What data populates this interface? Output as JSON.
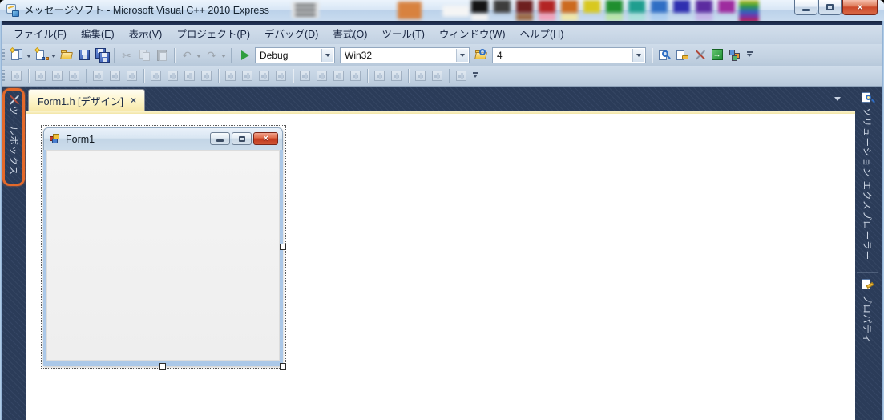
{
  "window": {
    "title": "メッセージソフト - Microsoft Visual C++ 2010 Express"
  },
  "menubar": {
    "items": [
      {
        "label": "ファイル(F)"
      },
      {
        "label": "編集(E)"
      },
      {
        "label": "表示(V)"
      },
      {
        "label": "プロジェクト(P)"
      },
      {
        "label": "デバッグ(D)"
      },
      {
        "label": "書式(O)"
      },
      {
        "label": "ツール(T)"
      },
      {
        "label": "ウィンドウ(W)"
      },
      {
        "label": "ヘルプ(H)"
      }
    ]
  },
  "toolbar": {
    "debug_combo_value": "Debug",
    "platform_combo_value": "Win32",
    "find_combo_value": "4"
  },
  "tabstrip": {
    "active_tab": {
      "label": "Form1.h [デザイン]",
      "close_glyph": "×"
    }
  },
  "left_panel": {
    "toolbox_tab": {
      "label": "ツールボックス"
    }
  },
  "right_panel": {
    "tabs": [
      {
        "label": "ソリューション エクスプローラー"
      },
      {
        "label": "プロパティ"
      }
    ]
  },
  "designer": {
    "form": {
      "title": "Form1",
      "close_glyph": "×"
    }
  },
  "colors": {
    "dock_background": "#2B3C59",
    "active_tab": "#FDF4C8",
    "highlight_ring": "#E4692A",
    "close_button": "#C2371D",
    "menubar_background": "#C9D6E5"
  },
  "palette": {
    "blocks": {
      "menu": "#e6e6e6",
      "orange": "#d8823f",
      "white": "#f5f5f5"
    },
    "row1": [
      "#141414",
      "#3d3d3d",
      "#6e1f1f",
      "#b32424",
      "#cc6a1f",
      "#d8c81f",
      "#1f8f2f",
      "#1f9e8f",
      "#2f6ec4",
      "#2f2fb0",
      "#5c2ba0",
      "#9e2b9e"
    ],
    "row2": [
      "#f2f2f2",
      "#9c6b47",
      "#f0a0b8",
      "#efe6a8",
      "#b8e4a8",
      "#a8e0da",
      "#aacdf0",
      "#c4b2e8"
    ]
  }
}
